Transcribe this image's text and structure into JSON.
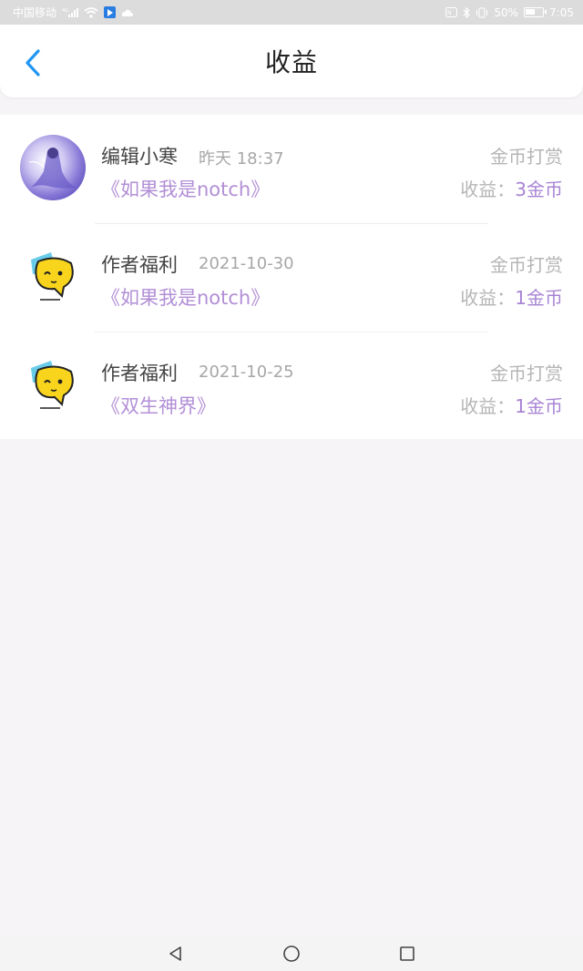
{
  "status_bar": {
    "carrier": "中国移动",
    "network": "4G",
    "battery": "50%",
    "time": "7:05"
  },
  "header": {
    "title": "收益",
    "accent_color": "#2196f3"
  },
  "records": [
    {
      "name": "编辑小寒",
      "time": "昨天 18:37",
      "book": "《如果我是notch》",
      "type": "金币打赏",
      "income_label": "收益：",
      "income_value": "3金币",
      "avatar": "editor-avatar"
    },
    {
      "name": "作者福利",
      "time": "2021-10-30",
      "book": "《如果我是notch》",
      "type": "金币打赏",
      "income_label": "收益：",
      "income_value": "1金币",
      "avatar": "chat-bubble-avatar"
    },
    {
      "name": "作者福利",
      "time": "2021-10-25",
      "book": "《双生神界》",
      "type": "金币打赏",
      "income_label": "收益：",
      "income_value": "1金币",
      "avatar": "chat-bubble-avatar"
    }
  ],
  "nav_bar": {
    "back": "back-triangle-icon",
    "home": "home-circle-icon",
    "recents": "recents-square-icon"
  }
}
